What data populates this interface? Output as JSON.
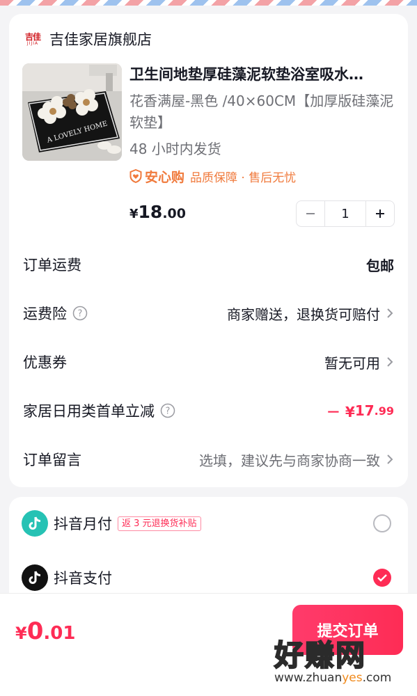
{
  "shop": {
    "logo_cn": "吉佳",
    "logo_en": "JIJIA",
    "name": "吉佳家居旗舰店"
  },
  "product": {
    "title": "卫生间地垫厚硅藻泥软垫浴室吸水…",
    "spec": "花香满屋-黑色 /40×60CM【加厚版硅藻泥软垫】",
    "ship_time": "48 小时内发货",
    "guarantee_brand": "安心购",
    "guarantee_text": "品质保障 · 售后无忧",
    "thumb_caption": "A LOVELY HOME",
    "price_currency": "¥",
    "price_int": "18",
    "price_dec": ".00",
    "quantity": "1",
    "minus_symbol": "−",
    "plus_symbol": "+"
  },
  "rows": {
    "shipping_fee": {
      "label": "订单运费",
      "value": "包邮"
    },
    "shipping_insurance": {
      "label": "运费险",
      "value": "商家赠送，退换货可赔付"
    },
    "coupon": {
      "label": "优惠券",
      "value": "暂无可用"
    },
    "discount": {
      "label": "家居日用类首单立减",
      "value_prefix": "－ ¥",
      "value_int": "17",
      "value_dec": ".99"
    },
    "remark": {
      "label": "订单留言",
      "value": "选填，建议先与商家协商一致"
    }
  },
  "payment": {
    "monthly": {
      "name": "抖音月付",
      "promo": "返 3 元退换货补贴",
      "selected": false
    },
    "pay": {
      "name": "抖音支付",
      "selected": true
    }
  },
  "footer": {
    "total_currency": "¥",
    "total_int": "0",
    "total_dec": ".01",
    "submit_label": "提交订单"
  },
  "watermark": {
    "text": "好赚网",
    "url_prefix": "www.zhuan",
    "url_highlight": "yes",
    "url_suffix": ".com"
  },
  "colors": {
    "accent": "#fe2c55",
    "guarantee": "#f07a3c",
    "text_secondary": "#6e6f75"
  }
}
